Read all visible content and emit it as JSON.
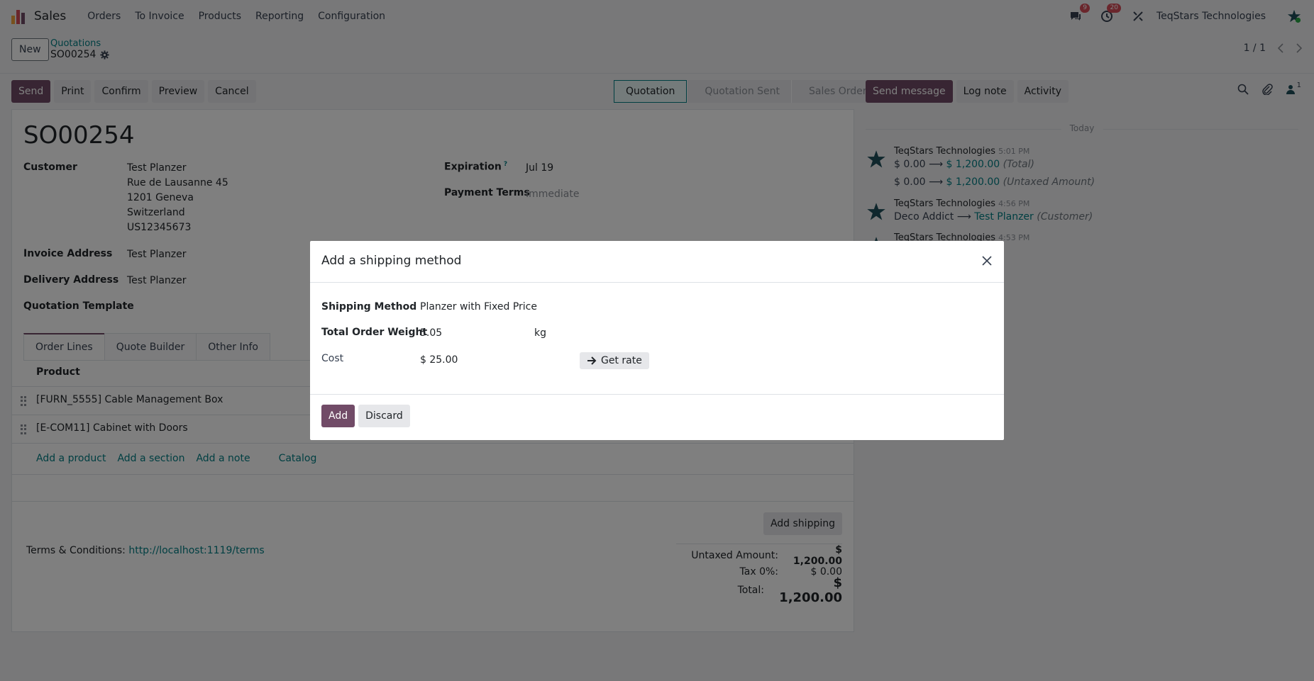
{
  "navbar": {
    "app_name": "Sales",
    "menu": [
      "Orders",
      "To Invoice",
      "Products",
      "Reporting",
      "Configuration"
    ],
    "messages_badge": "9",
    "activities_badge": "20",
    "company": "TeqStars Technologies"
  },
  "control": {
    "new_label": "New",
    "breadcrumb_parent": "Quotations",
    "breadcrumb_current": "SO00254",
    "pager": "1 / 1"
  },
  "actions": {
    "send": "Send",
    "print": "Print",
    "confirm": "Confirm",
    "preview": "Preview",
    "cancel": "Cancel"
  },
  "status_steps": [
    "Quotation",
    "Quotation Sent",
    "Sales Order"
  ],
  "chatter": {
    "send_message": "Send message",
    "log_note": "Log note",
    "activity": "Activity",
    "followers_count": "1",
    "today_label": "Today",
    "messages": [
      {
        "author": "TeqStars Technologies",
        "time": "5:01 PM",
        "lines": [
          {
            "old": "$ 0.00",
            "new": "$ 1,200.00",
            "field": "(Total)"
          },
          {
            "old": "$ 0.00",
            "new": "$ 1,200.00",
            "field": "(Untaxed Amount)"
          }
        ]
      },
      {
        "author": "TeqStars Technologies",
        "time": "4:56 PM",
        "lines": [
          {
            "old": "Deco Addict",
            "new": "Test Planzer",
            "field": "(Customer)"
          }
        ]
      },
      {
        "author": "TeqStars Technologies",
        "time": "4:53 PM",
        "lines": []
      }
    ]
  },
  "form": {
    "name": "SO00254",
    "customer_label": "Customer",
    "customer_lines": [
      "Test Planzer",
      "Rue de Lausanne 45",
      "1201 Geneva",
      "Switzerland",
      "US12345673"
    ],
    "invoice_label": "Invoice Address",
    "invoice_value": "Test Planzer",
    "delivery_label": "Delivery Address",
    "delivery_value": "Test Planzer",
    "template_label": "Quotation Template",
    "expiration_label": "Expiration",
    "expiration_help": "?",
    "expiration_value": "Jul 19",
    "payment_label": "Payment Terms",
    "payment_placeholder": "Immediate",
    "tabs": [
      "Order Lines",
      "Quote Builder",
      "Other Info"
    ],
    "product_header": "Product",
    "lines": [
      "[FURN_5555] Cable Management Box",
      "[E-COM11] Cabinet with Doors"
    ],
    "add_product": "Add a product",
    "add_section": "Add a section",
    "add_note": "Add a note",
    "catalog": "Catalog",
    "add_shipping": "Add shipping",
    "terms_label": "Terms & Conditions:",
    "terms_link": "http://localhost:1119/terms",
    "untaxed_label": "Untaxed Amount:",
    "untaxed_value": "$ 1,200.00",
    "tax_label": "Tax 0%:",
    "tax_value": "$ 0.00",
    "total_label": "Total:",
    "total_value": "$ 1,200.00"
  },
  "modal": {
    "title": "Add a shipping method",
    "method_label": "Shipping Method",
    "method_value": "Planzer with Fixed Price",
    "weight_label": "Total Order Weight",
    "weight_value": "5.05",
    "weight_unit": "kg",
    "cost_label": "Cost",
    "cost_value": "$ 25.00",
    "get_rate": "Get rate",
    "add": "Add",
    "discard": "Discard"
  },
  "colors": {
    "primary": "#714b67",
    "link": "#017e84"
  }
}
